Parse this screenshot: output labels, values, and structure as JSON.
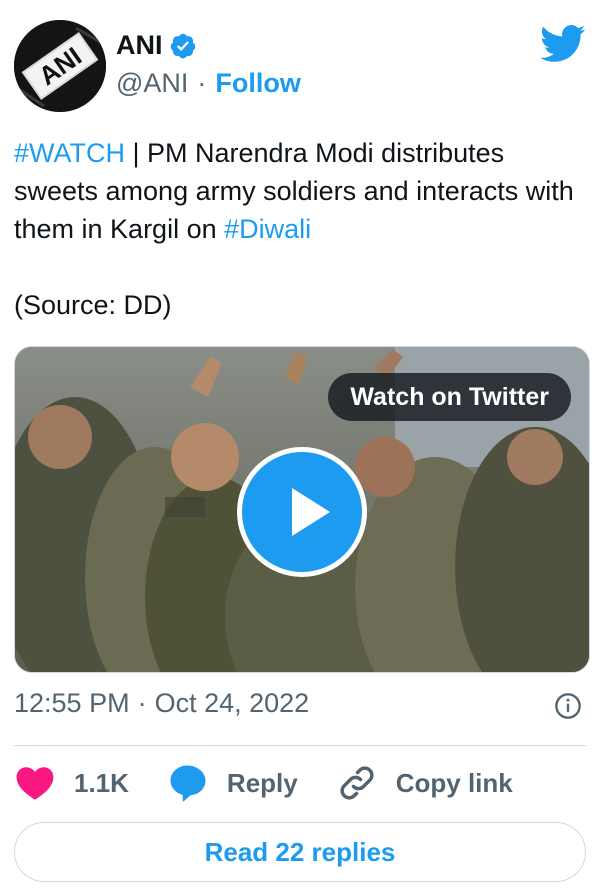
{
  "account": {
    "avatar_text": "ANI",
    "name": "ANI",
    "verified": true,
    "handle": "@ANI",
    "separator": "·",
    "follow_label": "Follow"
  },
  "tweet": {
    "hashtag1": "#WATCH",
    "text1": " | PM Narendra Modi distributes sweets among army soldiers and interacts with them in Kargil on ",
    "hashtag2": "#Diwali",
    "source": "(Source: DD)"
  },
  "media": {
    "watch_label": "Watch on Twitter"
  },
  "meta": {
    "time": "12:55 PM",
    "separator": "·",
    "date": "Oct 24, 2022"
  },
  "actions": {
    "likes": "1.1K",
    "reply_label": "Reply",
    "copy_label": "Copy link"
  },
  "read_replies_label": "Read 22 replies",
  "colors": {
    "accent": "#1d9bf0",
    "like": "#f91880",
    "muted": "#536471"
  }
}
